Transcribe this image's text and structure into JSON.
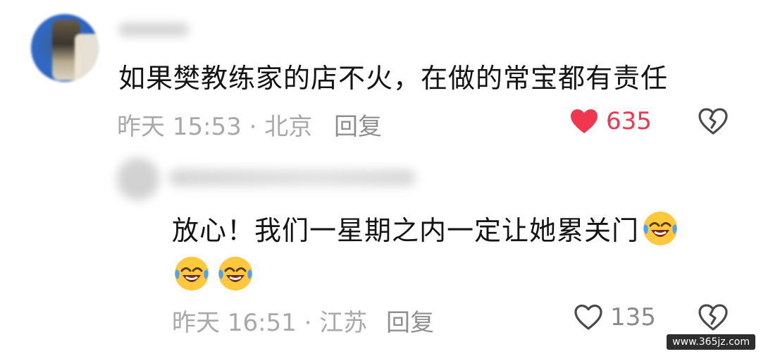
{
  "comment1": {
    "text": "如果樊教练家的店不火，在做的常宝都有责任",
    "time_location": "昨天 15:53 · 北京",
    "reply_label": "回复",
    "likes": "635",
    "liked": true
  },
  "comment2": {
    "text": "放心！我们一星期之内一定让她累关门",
    "emoji": "laughing-crying-emoji",
    "time_location": "昨天 16:51 · 江苏",
    "reply_label": "回复",
    "likes": "135",
    "liked": false
  },
  "colors": {
    "liked_red": "#f0374f",
    "meta_gray": "#a9a9a9"
  },
  "watermark": "www.365jz.com"
}
